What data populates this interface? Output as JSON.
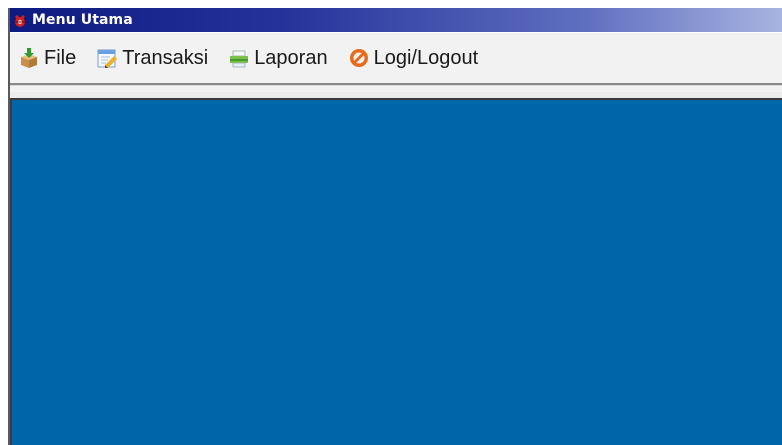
{
  "window": {
    "title": "Menu Utama",
    "title_icon": "app-bug-icon"
  },
  "menubar": {
    "items": [
      {
        "label": "File",
        "icon": "box-download-icon"
      },
      {
        "label": "Transaksi",
        "icon": "notepad-edit-icon"
      },
      {
        "label": "Laporan",
        "icon": "printer-icon"
      },
      {
        "label": "Logi/Logout",
        "icon": "no-entry-icon"
      }
    ]
  },
  "colors": {
    "desktop_background": "#0066aa",
    "titlebar_start": "#0d1a80",
    "titlebar_end": "#a8b4e0"
  }
}
